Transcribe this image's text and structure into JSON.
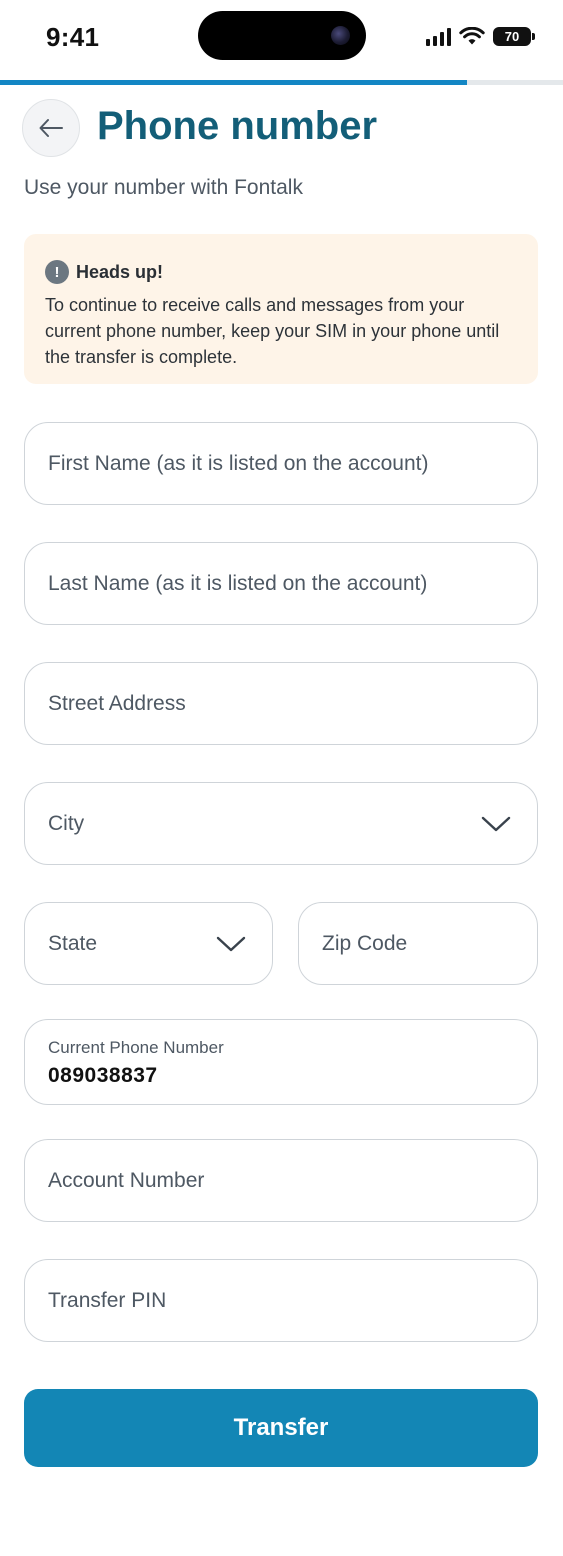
{
  "status_bar": {
    "time": "9:41",
    "battery": "70"
  },
  "progress": {
    "value": 0.83
  },
  "header": {
    "title": "Phone number",
    "subtitle": "Use your number with Fontalk"
  },
  "alert": {
    "icon_glyph": "!",
    "title": "Heads up!",
    "body": "To continue to receive calls and messages from your current phone number, keep your SIM in your phone until the transfer is complete."
  },
  "form": {
    "first_name": {
      "placeholder": "First Name  (as it is listed on the account)"
    },
    "last_name": {
      "placeholder": "Last Name (as it is listed on the account)"
    },
    "street": {
      "placeholder": "Street Address"
    },
    "city": {
      "placeholder": "City"
    },
    "state": {
      "placeholder": "State"
    },
    "zip": {
      "placeholder": "Zip Code"
    },
    "phone": {
      "label": "Current Phone Number",
      "value": "089038837"
    },
    "account": {
      "placeholder": "Account Number"
    },
    "pin": {
      "placeholder": "Transfer PIN"
    }
  },
  "actions": {
    "transfer_label": "Transfer"
  },
  "colors": {
    "accent": "#1386b5",
    "title": "#135e78",
    "alert_bg": "#fef4e8",
    "border": "#cfd4d9"
  },
  "icons": {
    "back": "arrow-left-icon",
    "alert": "exclamation-circle-icon",
    "dropdown": "chevron-down-icon"
  }
}
